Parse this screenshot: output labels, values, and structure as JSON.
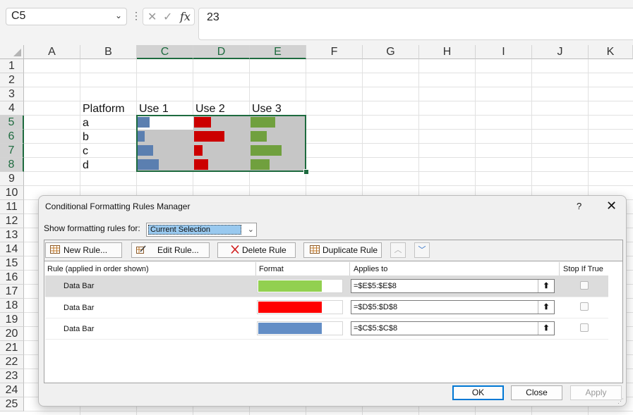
{
  "formula_bar": {
    "name_box": "C5",
    "cancel_icon": "✕",
    "enter_icon": "✓",
    "fx_label": "fx",
    "formula_value": "23"
  },
  "grid": {
    "columns": [
      "A",
      "B",
      "C",
      "D",
      "E",
      "F",
      "G",
      "H",
      "I",
      "J",
      "K"
    ],
    "rows": [
      "1",
      "2",
      "3",
      "4",
      "5",
      "6",
      "7",
      "8",
      "9",
      "10",
      "11",
      "12",
      "13",
      "14",
      "15",
      "16",
      "17",
      "18",
      "19",
      "20",
      "21",
      "22",
      "23",
      "24",
      "25"
    ],
    "headers": {
      "platform": "Platform",
      "use1": "Use 1",
      "use2": "Use 2",
      "use3": "Use 3"
    },
    "platforms": [
      "a",
      "b",
      "c",
      "d"
    ],
    "use1_bar_fraction": [
      0.22,
      0.13,
      0.28,
      0.39
    ],
    "use2_bar_fraction": [
      0.31,
      0.55,
      0.15,
      0.25
    ],
    "use3_bar_fraction": [
      0.45,
      0.29,
      0.57,
      0.35
    ],
    "colors": {
      "use1": "#5b7fb0",
      "use2": "#cc0000",
      "use3": "#70a03e",
      "selection": "#1e6b3f"
    }
  },
  "dialog": {
    "title": "Conditional Formatting Rules Manager",
    "help": "?",
    "close": "✕",
    "show_rules_label": "Show formatting rules for:",
    "show_rules_value": "Current Selection",
    "toolbar": {
      "new_rule": "New Rule...",
      "edit_rule": "Edit Rule...",
      "delete_rule": "Delete Rule",
      "duplicate_rule": "Duplicate Rule"
    },
    "columns": {
      "rule": "Rule (applied in order shown)",
      "format": "Format",
      "applies_to": "Applies to",
      "stop_if_true": "Stop If True"
    },
    "rules": [
      {
        "name": "Data Bar",
        "applies_to": "=$E$5:$E$8",
        "color": "#92d050"
      },
      {
        "name": "Data Bar",
        "applies_to": "=$D$5:$D$8",
        "color": "#ff0000"
      },
      {
        "name": "Data Bar",
        "applies_to": "=$C$5:$C$8",
        "color": "#638ec6"
      }
    ],
    "buttons": {
      "ok": "OK",
      "close": "Close",
      "apply": "Apply"
    }
  }
}
